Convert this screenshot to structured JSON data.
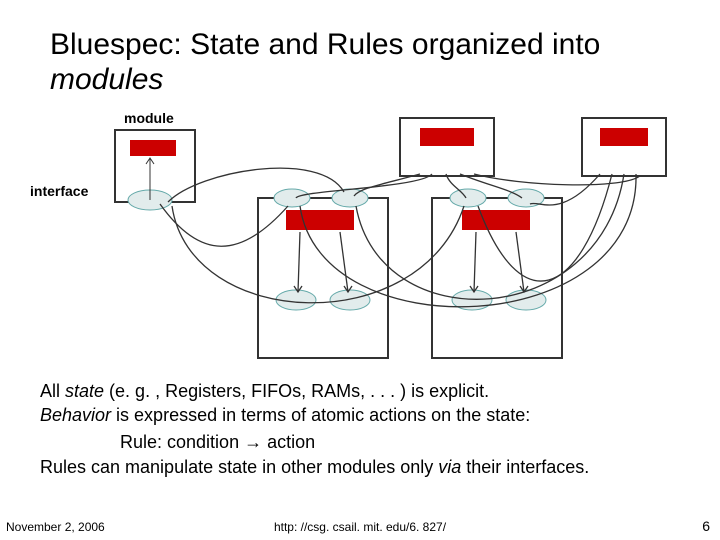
{
  "title_part1": "Bluespec:  State and Rules organized into ",
  "title_part2_italic": "modules",
  "labels": {
    "module": "module",
    "interface": "interface"
  },
  "body": {
    "line1_prefix": "All ",
    "line1_italic": "state",
    "line1_rest": " (e. g. , Registers, FIFOs, RAMs, . . . ) is explicit.",
    "line2_italic": "Behavior",
    "line2_rest": " is expressed in terms of atomic actions on the state:",
    "rule_line_prefix": "Rule: condition ",
    "rule_line_arrow": "→",
    "rule_line_suffix": " action",
    "line3_prefix": "Rules can manipulate state in other modules only ",
    "line3_italic": "via",
    "line3_rest": " their interfaces."
  },
  "footer": {
    "date": "November 2, 2006",
    "url": "http: //csg. csail. mit. edu/6. 827/",
    "page": "6"
  },
  "style": {
    "red": "#cc0000",
    "frame": "#333333",
    "feather": "#559999",
    "wire": "#333333"
  }
}
